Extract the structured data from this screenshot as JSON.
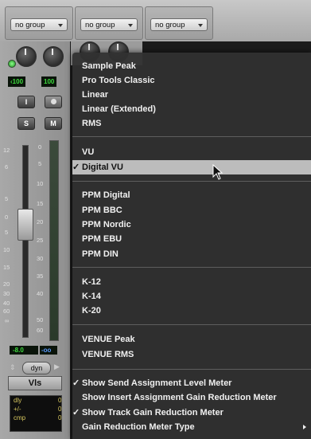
{
  "groups": [
    {
      "label": "no group"
    },
    {
      "label": "no group"
    },
    {
      "label": "no group"
    }
  ],
  "pan": {
    "left": "‹100",
    "right": "100"
  },
  "buttons": {
    "record": "I",
    "solo": "S",
    "mute": "M"
  },
  "fader_scale": [
    "12",
    "6",
    "5",
    "0",
    "5",
    "10",
    "15",
    "20",
    "30",
    "40",
    "60",
    "∞"
  ],
  "meter_scale": [
    "0",
    "5",
    "10",
    "15",
    "20",
    "25",
    "30",
    "35",
    "40",
    "50",
    "60"
  ],
  "volume": {
    "value": "-8.0",
    "pan_value": "-oo"
  },
  "dyn_label": "dyn",
  "track_name": "Vls",
  "comments": [
    {
      "key": "dly",
      "val": "0"
    },
    {
      "key": "+/-",
      "val": "0"
    },
    {
      "key": "cmp",
      "val": "0"
    }
  ],
  "menu": {
    "group1": [
      "Sample Peak",
      "Pro Tools Classic",
      "Linear",
      "Linear (Extended)",
      "RMS"
    ],
    "group2": [
      {
        "label": "VU",
        "checked": false
      },
      {
        "label": "Digital VU",
        "checked": true
      }
    ],
    "group3": [
      "PPM Digital",
      "PPM BBC",
      "PPM Nordic",
      "PPM EBU",
      "PPM DIN"
    ],
    "group4": [
      "K-12",
      "K-14",
      "K-20"
    ],
    "group5": [
      "VENUE Peak",
      "VENUE RMS"
    ],
    "group6": [
      {
        "label": "Show Send Assignment Level Meter",
        "checked": true
      },
      {
        "label": "Show Insert Assignment Gain Reduction Meter",
        "checked": false
      },
      {
        "label": "Show Track Gain Reduction Meter",
        "checked": true
      },
      {
        "label": "Gain Reduction Meter Type",
        "checked": false,
        "submenu": true
      }
    ],
    "check_glyph": "✓"
  }
}
